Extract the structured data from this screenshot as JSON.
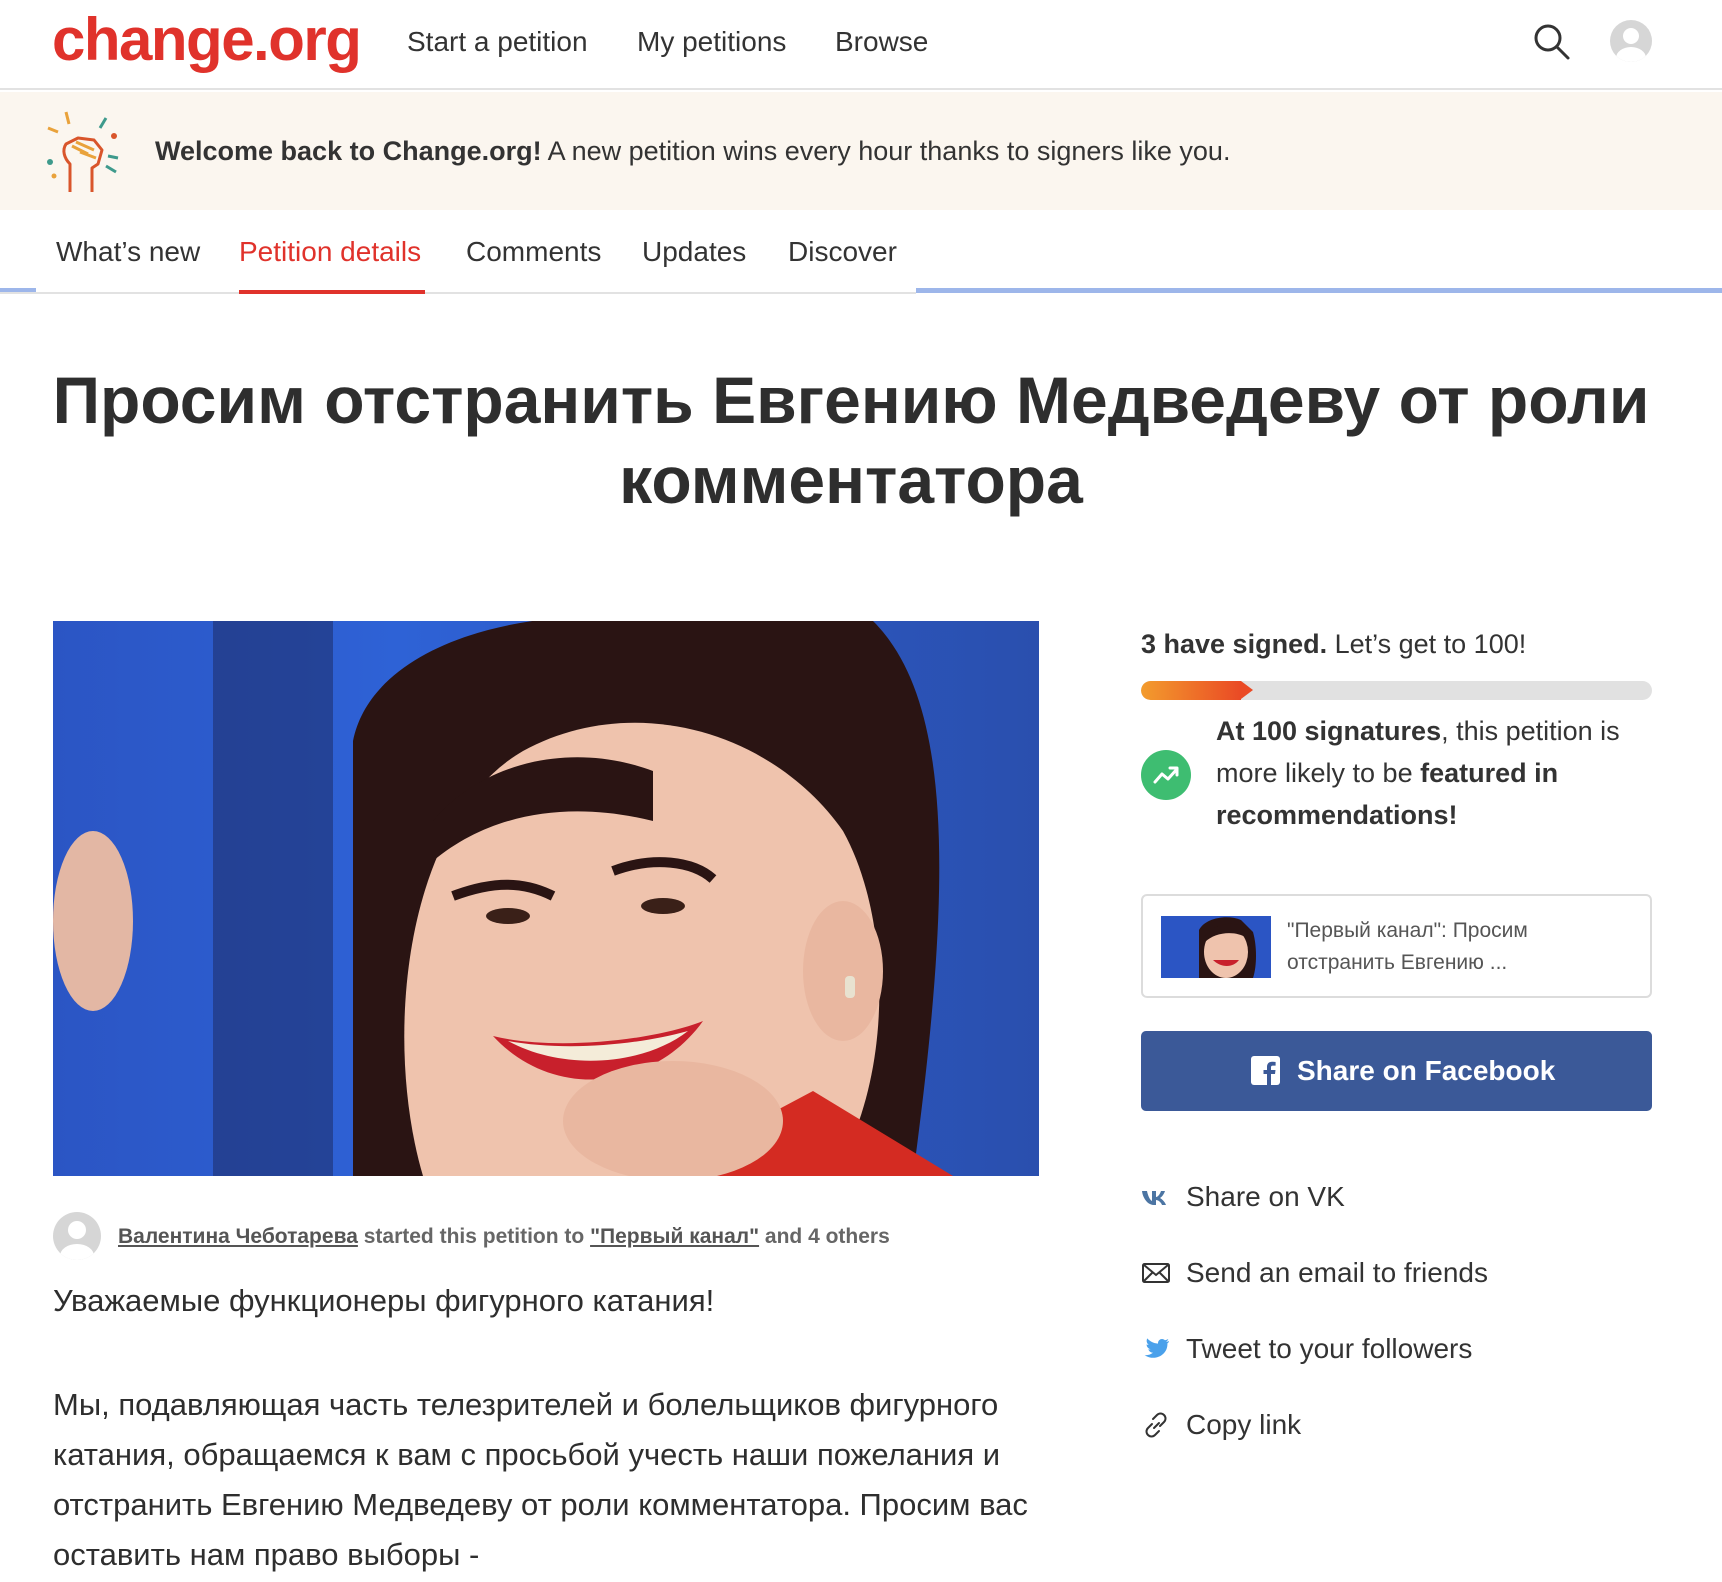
{
  "header": {
    "logo": "change.org",
    "nav": [
      "Start a petition",
      "My petitions",
      "Browse"
    ]
  },
  "welcome": {
    "bold": "Welcome back to Change.org!",
    "text": " A new petition wins every hour thanks to signers like you."
  },
  "tabs": {
    "items": [
      "What’s new",
      "Petition details",
      "Comments",
      "Updates",
      "Discover"
    ],
    "active": "Petition details"
  },
  "petition": {
    "title": "Просим отстранить Евгению Медведеву от роли комментатора",
    "starter_name": "Валентина Чеботарева",
    "started_text": " started this petition to ",
    "target": "\"Первый канал\"",
    "and_text": " and ",
    "others": "4 others",
    "greeting": "Уважаемые функционеры фигурного катания!",
    "paragraph": "Мы, подавляющая часть телезрителей и болельщиков фигурного катания, обращаемся к вам с просьбой учесть наши пожелания и отстранить Евгению Медведеву от роли комментатора. Просим вас оставить нам право выборы -"
  },
  "sidebar": {
    "signed_count": "3 have signed.",
    "signed_goal": " Let’s get to 100!",
    "signatures": 3,
    "goal": 100,
    "progress_fraction": 0.22,
    "milestone_bold": "At 100 signatures",
    "milestone_mid": ", this petition is more likely to be ",
    "milestone_bold2": "featured in recommendations!",
    "preview_text": "\"Первый канал\": Просим отстранить Евгению ...",
    "facebook_label": "Share on Facebook",
    "share_options": [
      "Share on VK",
      "Send an email to friends",
      "Tweet to your followers",
      "Copy link"
    ]
  },
  "colors": {
    "brand_red": "#e0322b",
    "facebook_blue": "#3b5998",
    "progress_start": "#f39c2d",
    "progress_end": "#ea4a25",
    "trend_green": "#3ebd71",
    "twitter_blue": "#4aa1eb",
    "vk_blue": "#4c75a3"
  },
  "icons": {
    "search": "search-icon",
    "avatar": "user-avatar-icon",
    "trend": "trending-up-icon",
    "facebook": "facebook-icon",
    "vk": "vk-icon",
    "email": "envelope-icon",
    "twitter": "twitter-bird-icon",
    "link": "link-icon"
  }
}
